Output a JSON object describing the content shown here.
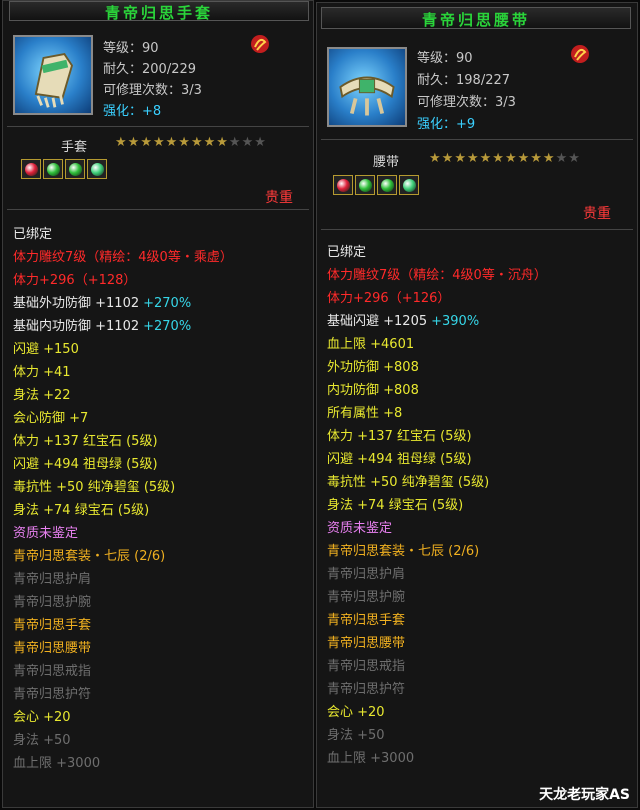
{
  "colors": {
    "title": "#2ad43a",
    "rare": "#ff3a3a",
    "quality": "#3ad0ff"
  },
  "left": {
    "title": "青帝归思手套",
    "level": "等级：90",
    "durability": "耐久：200/229",
    "repairs": "可修理次数：3/3",
    "enhance_label": "强化：",
    "enhance_value": "+8",
    "slot": "手套",
    "stars_on": 9,
    "stars_total": 12,
    "gems": [
      "ruby",
      "emerald",
      "emerald",
      "jade"
    ],
    "rarity": "贵重",
    "attrs": [
      {
        "t": "已绑定",
        "c": "white"
      },
      {
        "t": "体力雕纹7级（精绘：4级0等・乘虚）",
        "c": "red"
      },
      {
        "t": "体力+296（+128）",
        "c": "red"
      },
      {
        "t": "基础外功防御 +1102",
        "c": "white",
        "x": "+270%",
        "xc": "cyan"
      },
      {
        "t": "基础内功防御 +1102",
        "c": "white",
        "x": "+270%",
        "xc": "cyan"
      },
      {
        "t": "闪避 +150",
        "c": "yellow"
      },
      {
        "t": "体力 +41",
        "c": "yellow"
      },
      {
        "t": "身法 +22",
        "c": "yellow"
      },
      {
        "t": "会心防御 +7",
        "c": "yellow"
      },
      {
        "t": "体力 +137 红宝石 (5级)",
        "c": "yellow"
      },
      {
        "t": "闪避 +494 祖母绿 (5级)",
        "c": "yellow"
      },
      {
        "t": "毒抗性 +50 纯净碧玺 (5级)",
        "c": "yellow"
      },
      {
        "t": "身法 +74 绿宝石 (5级)",
        "c": "yellow"
      },
      {
        "t": "资质未鉴定",
        "c": "pink"
      },
      {
        "t": "青帝归思套装・七辰 (2/6)",
        "c": "gold"
      },
      {
        "t": "青帝归思护肩",
        "c": "gray"
      },
      {
        "t": "青帝归思护腕",
        "c": "gray"
      },
      {
        "t": "青帝归思手套",
        "c": "gold"
      },
      {
        "t": "青帝归思腰带",
        "c": "gold"
      },
      {
        "t": "青帝归思戒指",
        "c": "gray"
      },
      {
        "t": "青帝归思护符",
        "c": "gray"
      },
      {
        "t": "会心 +20",
        "c": "yellow"
      },
      {
        "t": "身法 +50",
        "c": "gray"
      },
      {
        "t": "血上限 +3000",
        "c": "gray"
      }
    ]
  },
  "right": {
    "title": "青帝归思腰带",
    "level": "等级：90",
    "durability": "耐久：198/227",
    "repairs": "可修理次数：3/3",
    "enhance_label": "强化：",
    "enhance_value": "+9",
    "slot": "腰带",
    "stars_on": 10,
    "stars_total": 12,
    "gems": [
      "ruby",
      "emerald",
      "emerald",
      "jade"
    ],
    "rarity": "贵重",
    "attrs": [
      {
        "t": "已绑定",
        "c": "white"
      },
      {
        "t": "体力雕纹7级（精绘：4级0等・沉舟）",
        "c": "red"
      },
      {
        "t": "体力+296（+126）",
        "c": "red"
      },
      {
        "t": "基础闪避 +1205",
        "c": "white",
        "x": "+390%",
        "xc": "cyan"
      },
      {
        "t": "血上限 +4601",
        "c": "yellow"
      },
      {
        "t": "外功防御 +808",
        "c": "yellow"
      },
      {
        "t": "内功防御 +808",
        "c": "yellow"
      },
      {
        "t": "所有属性 +8",
        "c": "yellow"
      },
      {
        "t": "体力 +137 红宝石 (5级)",
        "c": "yellow"
      },
      {
        "t": "闪避 +494 祖母绿 (5级)",
        "c": "yellow"
      },
      {
        "t": "毒抗性 +50 纯净碧玺 (5级)",
        "c": "yellow"
      },
      {
        "t": "身法 +74 绿宝石 (5级)",
        "c": "yellow"
      },
      {
        "t": "资质未鉴定",
        "c": "pink"
      },
      {
        "t": "青帝归思套装・七辰 (2/6)",
        "c": "gold"
      },
      {
        "t": "青帝归思护肩",
        "c": "gray"
      },
      {
        "t": "青帝归思护腕",
        "c": "gray"
      },
      {
        "t": "青帝归思手套",
        "c": "gold"
      },
      {
        "t": "青帝归思腰带",
        "c": "gold"
      },
      {
        "t": "青帝归思戒指",
        "c": "gray"
      },
      {
        "t": "青帝归思护符",
        "c": "gray"
      },
      {
        "t": "会心 +20",
        "c": "yellow"
      },
      {
        "t": "身法 +50",
        "c": "gray"
      },
      {
        "t": "血上限 +3000",
        "c": "gray"
      }
    ]
  },
  "watermark": "天龙老玩家AS"
}
